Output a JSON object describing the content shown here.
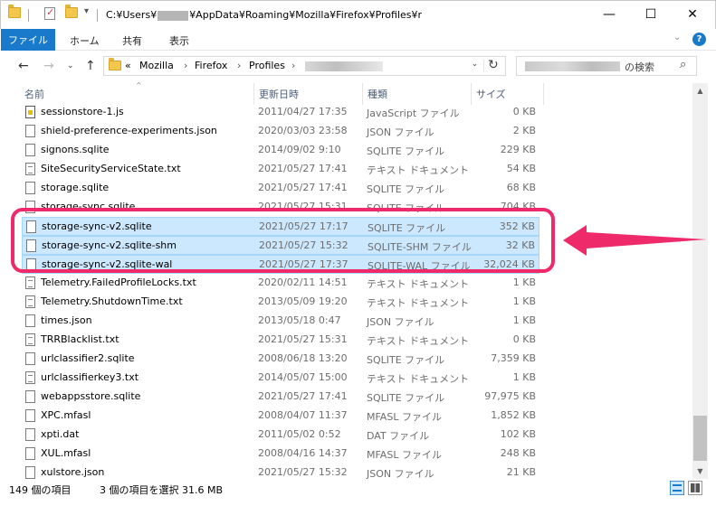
{
  "window": {
    "title_prefix": "C:¥Users¥",
    "title_suffix": "¥AppData¥Roaming¥Mozilla¥Firefox¥Profiles¥r",
    "minimize": "—",
    "maximize": "☐",
    "close": "✕"
  },
  "ribbon": {
    "tabs": [
      "ファイル",
      "ホーム",
      "共有",
      "表示"
    ],
    "collapse": "⌄",
    "help": "?"
  },
  "address": {
    "prefix": "«",
    "crumbs": [
      "Mozilla",
      "Firefox",
      "Profiles"
    ],
    "separator": "›",
    "dropdown": "⌄",
    "refresh": "↻"
  },
  "search": {
    "placeholder_suffix": "の検索",
    "icon": "search-icon"
  },
  "columns": {
    "name": "名前",
    "date": "更新日時",
    "type": "種類",
    "size": "サイズ"
  },
  "files": [
    {
      "name": "sessionstore-1.js",
      "date": "2011/04/27 17:35",
      "type": "JavaScript ファイル",
      "size": "0 KB",
      "icon": "js",
      "selected": false
    },
    {
      "name": "shield-preference-experiments.json",
      "date": "2020/03/03 23:58",
      "type": "JSON ファイル",
      "size": "2 KB",
      "icon": "file",
      "selected": false
    },
    {
      "name": "signons.sqlite",
      "date": "2014/09/02 9:10",
      "type": "SQLITE ファイル",
      "size": "229 KB",
      "icon": "file",
      "selected": false
    },
    {
      "name": "SiteSecurityServiceState.txt",
      "date": "2021/05/27 17:41",
      "type": "テキスト ドキュメント",
      "size": "54 KB",
      "icon": "txt",
      "selected": false
    },
    {
      "name": "storage.sqlite",
      "date": "2021/05/27 17:41",
      "type": "SQLITE ファイル",
      "size": "68 KB",
      "icon": "file",
      "selected": false
    },
    {
      "name": "storage-sync.sqlite",
      "date": "2021/05/27 15:31",
      "type": "SQLITE ファイル",
      "size": "704 KB",
      "icon": "file",
      "selected": false
    },
    {
      "name": "storage-sync-v2.sqlite",
      "date": "2021/05/27 17:17",
      "type": "SQLITE ファイル",
      "size": "352 KB",
      "icon": "file",
      "selected": true
    },
    {
      "name": "storage-sync-v2.sqlite-shm",
      "date": "2021/05/27 15:32",
      "type": "SQLITE-SHM ファイル",
      "size": "32 KB",
      "icon": "file",
      "selected": true
    },
    {
      "name": "storage-sync-v2.sqlite-wal",
      "date": "2021/05/27 17:37",
      "type": "SQLITE-WAL ファイル",
      "size": "32,024 KB",
      "icon": "file",
      "selected": true
    },
    {
      "name": "Telemetry.FailedProfileLocks.txt",
      "date": "2020/02/11 14:51",
      "type": "テキスト ドキュメント",
      "size": "1 KB",
      "icon": "txt",
      "selected": false
    },
    {
      "name": "Telemetry.ShutdownTime.txt",
      "date": "2013/05/09 19:20",
      "type": "テキスト ドキュメント",
      "size": "1 KB",
      "icon": "txt",
      "selected": false
    },
    {
      "name": "times.json",
      "date": "2013/05/18 0:47",
      "type": "JSON ファイル",
      "size": "1 KB",
      "icon": "file",
      "selected": false
    },
    {
      "name": "TRRBlacklist.txt",
      "date": "2021/05/27 15:31",
      "type": "テキスト ドキュメント",
      "size": "0 KB",
      "icon": "txt",
      "selected": false
    },
    {
      "name": "urlclassifier2.sqlite",
      "date": "2008/06/18 13:20",
      "type": "SQLITE ファイル",
      "size": "7,359 KB",
      "icon": "file",
      "selected": false
    },
    {
      "name": "urlclassifierkey3.txt",
      "date": "2014/05/07 15:00",
      "type": "テキスト ドキュメント",
      "size": "1 KB",
      "icon": "txt",
      "selected": false
    },
    {
      "name": "webappsstore.sqlite",
      "date": "2021/05/27 17:41",
      "type": "SQLITE ファイル",
      "size": "97,975 KB",
      "icon": "file",
      "selected": false
    },
    {
      "name": "XPC.mfasl",
      "date": "2008/04/07 11:37",
      "type": "MFASL ファイル",
      "size": "1,852 KB",
      "icon": "file",
      "selected": false
    },
    {
      "name": "xpti.dat",
      "date": "2011/05/02 0:52",
      "type": "DAT ファイル",
      "size": "102 KB",
      "icon": "file",
      "selected": false
    },
    {
      "name": "XUL.mfasl",
      "date": "2008/04/16 14:37",
      "type": "MFASL ファイル",
      "size": "248 KB",
      "icon": "file",
      "selected": false
    },
    {
      "name": "xulstore.json",
      "date": "2021/05/27 15:32",
      "type": "JSON ファイル",
      "size": "21 KB",
      "icon": "file",
      "selected": false
    }
  ],
  "status": {
    "item_count": "149 個の項目",
    "selection": "3 個の項目を選択  31.6 MB"
  },
  "annotation": {
    "color": "#ee2a6b"
  }
}
